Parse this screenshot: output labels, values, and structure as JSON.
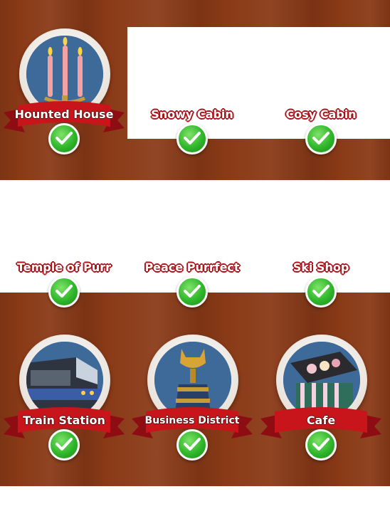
{
  "locations": [
    {
      "name": "Hounted House",
      "completed": true,
      "icon": "candles-icon",
      "has_medal": true
    },
    {
      "name": "Snowy Cabin",
      "completed": true,
      "icon": "",
      "has_medal": false
    },
    {
      "name": "Cosy Cabin",
      "completed": true,
      "icon": "",
      "has_medal": false
    },
    {
      "name": "Temple of Purr",
      "completed": true,
      "icon": "",
      "has_medal": false
    },
    {
      "name": "Peace Purrfect",
      "completed": true,
      "icon": "",
      "has_medal": false
    },
    {
      "name": "Ski Shop",
      "completed": true,
      "icon": "",
      "has_medal": false
    },
    {
      "name": "Train Station",
      "completed": true,
      "icon": "train-icon",
      "has_medal": true
    },
    {
      "name": "Business District",
      "completed": true,
      "icon": "cat-statue-icon",
      "has_medal": true
    },
    {
      "name": "Cafe",
      "completed": true,
      "icon": "cafe-counter-icon",
      "has_medal": true
    }
  ],
  "colors": {
    "wood": "#8a3a17",
    "ribbon": "#c8151c",
    "check": "#2fb62a",
    "medal_bg": "#3e6a9a"
  }
}
